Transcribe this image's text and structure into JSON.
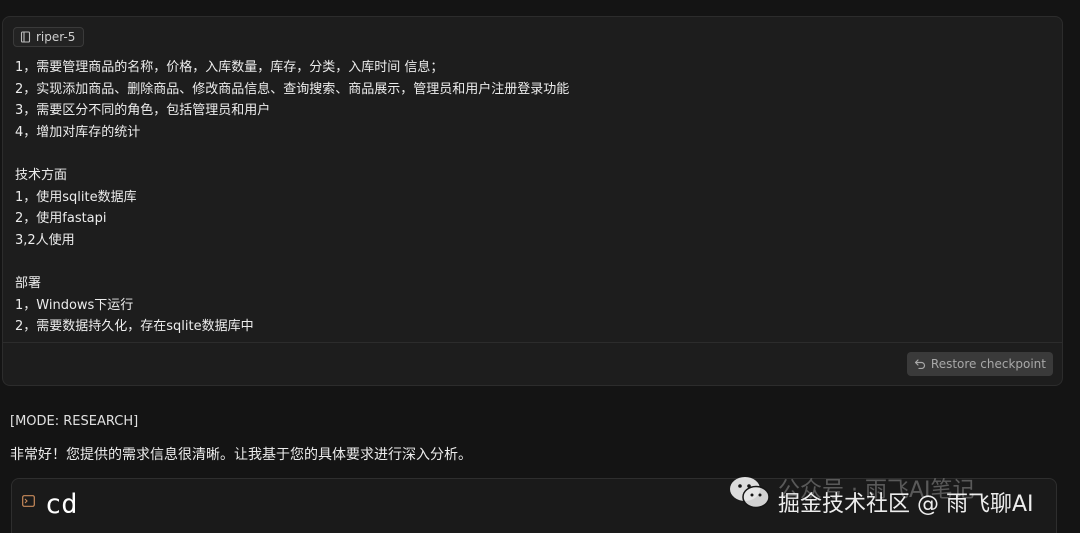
{
  "user_message": {
    "rule_chip_label": "riper-5",
    "lines": [
      "1，需要管理商品的名称，价格，入库数量，库存，分类，入库时间 信息；",
      "2，实现添加商品、删除商品、修改商品信息、查询搜索、商品展示，管理员和用户注册登录功能",
      "3，需要区分不同的角色，包括管理员和用户",
      "4，增加对库存的统计",
      "",
      "技术方面",
      "1，使用sqlite数据库",
      "2，使用fastapi",
      "3,2人使用",
      "",
      "部署",
      "1，Windows下运行",
      "2，需要数据持久化，存在sqlite数据库中"
    ],
    "restore_button_label": "Restore checkpoint"
  },
  "assistant": {
    "mode_tag": "[MODE: RESEARCH]",
    "intro_text": "非常好！您提供的需求信息很清晰。让我基于您的具体要求进行深入分析。",
    "terminal_command": "cd"
  },
  "watermark": {
    "line1": "公众号 · 雨飞AI笔记",
    "line2": "掘金技术社区 @ 雨飞聊AI"
  },
  "icons": {
    "rule_chip_icon": "book-icon",
    "restore_icon": "undo-arrow-icon",
    "terminal_icon": "terminal-icon",
    "watermark_icon": "wechat-logo-icon"
  },
  "colors": {
    "background": "#141414",
    "card": "#1d1d1d",
    "terminal_icon": "#c98a5a"
  }
}
